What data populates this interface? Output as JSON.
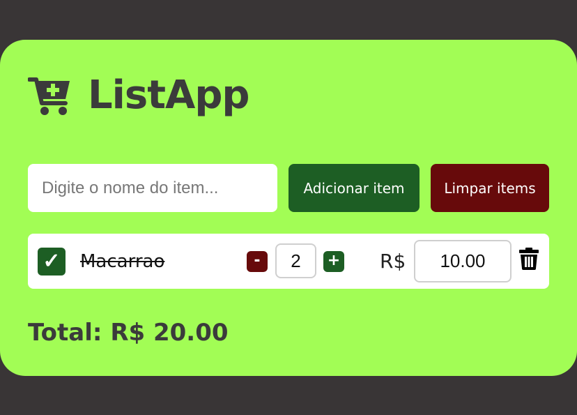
{
  "app": {
    "title": "ListApp",
    "cart_icon": "cart-plus-icon"
  },
  "form": {
    "input_placeholder": "Digite o nome do item...",
    "input_value": "",
    "add_label": "Adicionar item",
    "clear_label": "Limpar items"
  },
  "items": [
    {
      "checked": true,
      "check_glyph": "✓",
      "name": "Macarrao",
      "minus_label": "-",
      "quantity": "2",
      "plus_label": "+",
      "currency": "R$",
      "price": "10.00",
      "delete_icon": "trash-icon"
    }
  ],
  "total": {
    "label": "Total: R$ 20.00"
  },
  "colors": {
    "background": "#393536",
    "card": "#a2fd55",
    "primary_green": "#1d5e24",
    "danger_red": "#670a0b",
    "text_dark": "#3b3b3b"
  }
}
